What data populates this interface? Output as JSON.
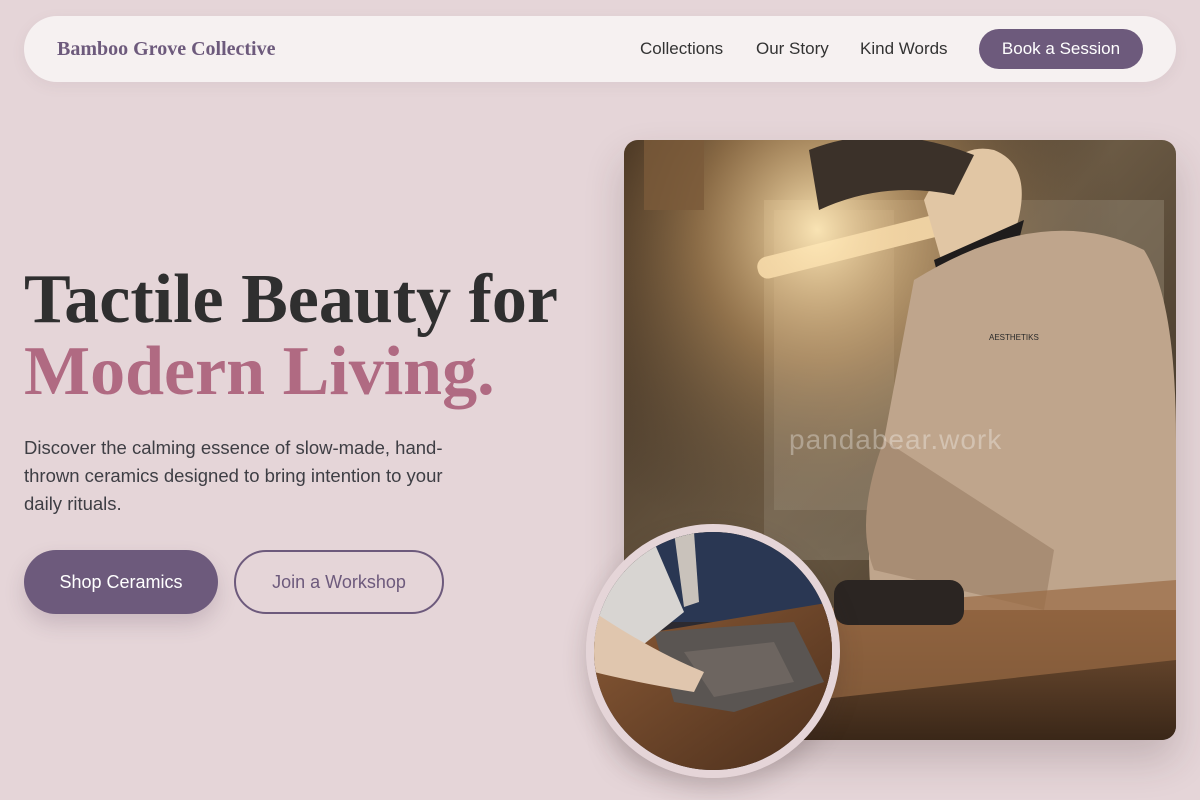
{
  "nav": {
    "brand": "Bamboo Grove Collective",
    "links": [
      "Collections",
      "Our Story",
      "Kind Words"
    ],
    "cta": "Book a Session"
  },
  "hero": {
    "heading_line1": "Tactile Beauty for",
    "heading_line2": "Modern Living.",
    "description": "Discover the calming essence of slow-made, hand-thrown ceramics designed to bring intention to your daily rituals.",
    "primary_button": "Shop Ceramics",
    "secondary_button": "Join a Workshop"
  },
  "images": {
    "main_watermark": "pandabear.work"
  },
  "colors": {
    "background": "#e5d5d8",
    "accent_purple": "#6d5a7c",
    "accent_rose": "#b06a82"
  }
}
